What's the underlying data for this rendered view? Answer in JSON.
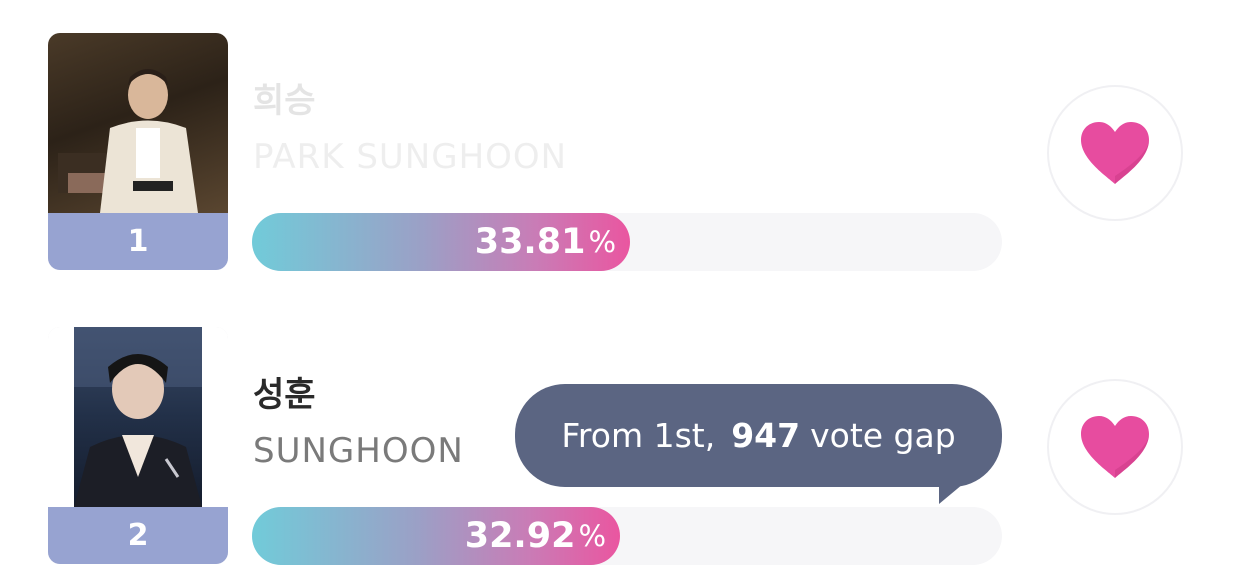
{
  "entries": [
    {
      "rank": "1",
      "name_kr": "희승",
      "name_en": "PARK SUNGHOON",
      "percent": "33.81",
      "percent_value": 33.81,
      "percent_sign": "%"
    },
    {
      "rank": "2",
      "name_kr": "성훈",
      "name_en": "SUNGHOON",
      "percent": "32.92",
      "percent_value": 32.92,
      "percent_sign": "%"
    }
  ],
  "tooltip": {
    "prefix": "From 1st,",
    "gap": "947",
    "suffix": "vote gap"
  },
  "icons": {
    "vote": "heart-icon"
  },
  "colors": {
    "rank_strip": "#97a3d1",
    "bar_start": "#71cbd9",
    "bar_end": "#ea56a0",
    "heart": "#e74c9f",
    "tooltip_bg": "#5b6582"
  }
}
